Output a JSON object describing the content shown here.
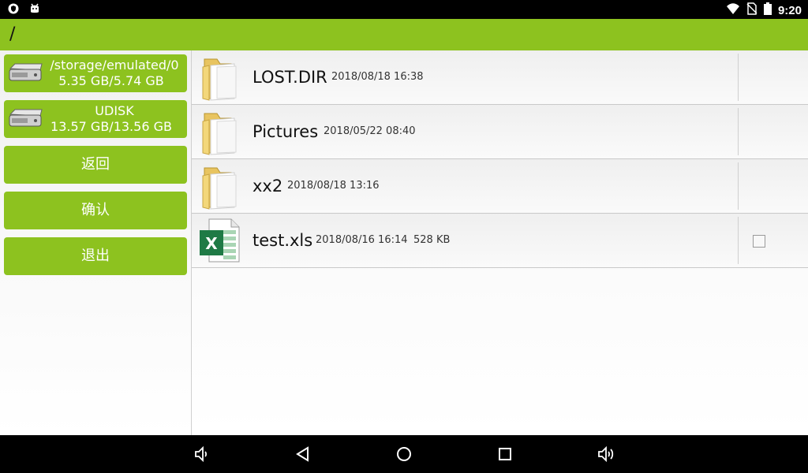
{
  "status_bar": {
    "time": "9:20",
    "left_icons": [
      "shield-icon",
      "android-icon"
    ],
    "right_icons": [
      "wifi-icon",
      "no-sim-icon",
      "battery-icon"
    ]
  },
  "path_bar": {
    "path": "/"
  },
  "sidebar": {
    "drives": [
      {
        "name": "/storage/emulated/0",
        "size": "5.35 GB/5.74 GB"
      },
      {
        "name": "UDISK",
        "size": "13.57 GB/13.56 GB"
      }
    ],
    "buttons": {
      "back_label": "返回",
      "confirm_label": "确认",
      "exit_label": "退出"
    }
  },
  "files": [
    {
      "name": "LOST.DIR",
      "date": "2018/08/18 16:38",
      "size": "",
      "type": "folder",
      "checkbox": false
    },
    {
      "name": "Pictures",
      "date": "2018/05/22 08:40",
      "size": "",
      "type": "folder",
      "checkbox": false
    },
    {
      "name": "xx2",
      "date": "2018/08/18 13:16",
      "size": "",
      "type": "folder",
      "checkbox": false
    },
    {
      "name": "test.xls",
      "date": "2018/08/16 16:14",
      "size": "528 KB",
      "type": "excel",
      "checkbox": true
    }
  ],
  "nav_bar": {
    "buttons": [
      "volume-down-icon",
      "back-icon",
      "home-icon",
      "recents-icon",
      "volume-up-icon"
    ]
  },
  "colors": {
    "accent": "#8dc21f",
    "bar": "#000000"
  }
}
